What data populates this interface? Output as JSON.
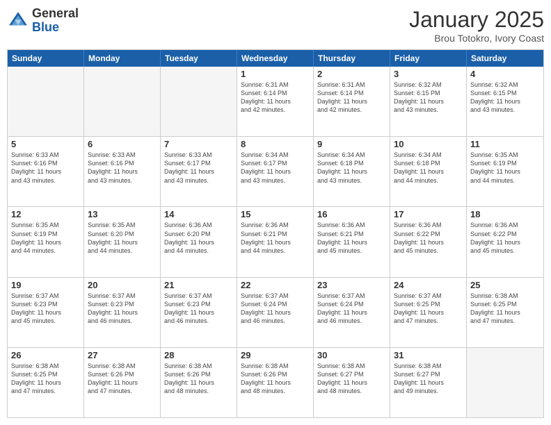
{
  "header": {
    "logo_general": "General",
    "logo_blue": "Blue",
    "month_title": "January 2025",
    "location": "Brou Totokro, Ivory Coast"
  },
  "days_of_week": [
    "Sunday",
    "Monday",
    "Tuesday",
    "Wednesday",
    "Thursday",
    "Friday",
    "Saturday"
  ],
  "weeks": [
    [
      {
        "day": "",
        "info": "",
        "empty": true
      },
      {
        "day": "",
        "info": "",
        "empty": true
      },
      {
        "day": "",
        "info": "",
        "empty": true
      },
      {
        "day": "1",
        "info": "Sunrise: 6:31 AM\nSunset: 6:14 PM\nDaylight: 11 hours\nand 42 minutes."
      },
      {
        "day": "2",
        "info": "Sunrise: 6:31 AM\nSunset: 6:14 PM\nDaylight: 11 hours\nand 42 minutes."
      },
      {
        "day": "3",
        "info": "Sunrise: 6:32 AM\nSunset: 6:15 PM\nDaylight: 11 hours\nand 43 minutes."
      },
      {
        "day": "4",
        "info": "Sunrise: 6:32 AM\nSunset: 6:15 PM\nDaylight: 11 hours\nand 43 minutes."
      }
    ],
    [
      {
        "day": "5",
        "info": "Sunrise: 6:33 AM\nSunset: 6:16 PM\nDaylight: 11 hours\nand 43 minutes."
      },
      {
        "day": "6",
        "info": "Sunrise: 6:33 AM\nSunset: 6:16 PM\nDaylight: 11 hours\nand 43 minutes."
      },
      {
        "day": "7",
        "info": "Sunrise: 6:33 AM\nSunset: 6:17 PM\nDaylight: 11 hours\nand 43 minutes."
      },
      {
        "day": "8",
        "info": "Sunrise: 6:34 AM\nSunset: 6:17 PM\nDaylight: 11 hours\nand 43 minutes."
      },
      {
        "day": "9",
        "info": "Sunrise: 6:34 AM\nSunset: 6:18 PM\nDaylight: 11 hours\nand 43 minutes."
      },
      {
        "day": "10",
        "info": "Sunrise: 6:34 AM\nSunset: 6:18 PM\nDaylight: 11 hours\nand 44 minutes."
      },
      {
        "day": "11",
        "info": "Sunrise: 6:35 AM\nSunset: 6:19 PM\nDaylight: 11 hours\nand 44 minutes."
      }
    ],
    [
      {
        "day": "12",
        "info": "Sunrise: 6:35 AM\nSunset: 6:19 PM\nDaylight: 11 hours\nand 44 minutes."
      },
      {
        "day": "13",
        "info": "Sunrise: 6:35 AM\nSunset: 6:20 PM\nDaylight: 11 hours\nand 44 minutes."
      },
      {
        "day": "14",
        "info": "Sunrise: 6:36 AM\nSunset: 6:20 PM\nDaylight: 11 hours\nand 44 minutes."
      },
      {
        "day": "15",
        "info": "Sunrise: 6:36 AM\nSunset: 6:21 PM\nDaylight: 11 hours\nand 44 minutes."
      },
      {
        "day": "16",
        "info": "Sunrise: 6:36 AM\nSunset: 6:21 PM\nDaylight: 11 hours\nand 45 minutes."
      },
      {
        "day": "17",
        "info": "Sunrise: 6:36 AM\nSunset: 6:22 PM\nDaylight: 11 hours\nand 45 minutes."
      },
      {
        "day": "18",
        "info": "Sunrise: 6:36 AM\nSunset: 6:22 PM\nDaylight: 11 hours\nand 45 minutes."
      }
    ],
    [
      {
        "day": "19",
        "info": "Sunrise: 6:37 AM\nSunset: 6:23 PM\nDaylight: 11 hours\nand 45 minutes."
      },
      {
        "day": "20",
        "info": "Sunrise: 6:37 AM\nSunset: 6:23 PM\nDaylight: 11 hours\nand 46 minutes."
      },
      {
        "day": "21",
        "info": "Sunrise: 6:37 AM\nSunset: 6:23 PM\nDaylight: 11 hours\nand 46 minutes."
      },
      {
        "day": "22",
        "info": "Sunrise: 6:37 AM\nSunset: 6:24 PM\nDaylight: 11 hours\nand 46 minutes."
      },
      {
        "day": "23",
        "info": "Sunrise: 6:37 AM\nSunset: 6:24 PM\nDaylight: 11 hours\nand 46 minutes."
      },
      {
        "day": "24",
        "info": "Sunrise: 6:37 AM\nSunset: 6:25 PM\nDaylight: 11 hours\nand 47 minutes."
      },
      {
        "day": "25",
        "info": "Sunrise: 6:38 AM\nSunset: 6:25 PM\nDaylight: 11 hours\nand 47 minutes."
      }
    ],
    [
      {
        "day": "26",
        "info": "Sunrise: 6:38 AM\nSunset: 6:25 PM\nDaylight: 11 hours\nand 47 minutes."
      },
      {
        "day": "27",
        "info": "Sunrise: 6:38 AM\nSunset: 6:26 PM\nDaylight: 11 hours\nand 47 minutes."
      },
      {
        "day": "28",
        "info": "Sunrise: 6:38 AM\nSunset: 6:26 PM\nDaylight: 11 hours\nand 48 minutes."
      },
      {
        "day": "29",
        "info": "Sunrise: 6:38 AM\nSunset: 6:26 PM\nDaylight: 11 hours\nand 48 minutes."
      },
      {
        "day": "30",
        "info": "Sunrise: 6:38 AM\nSunset: 6:27 PM\nDaylight: 11 hours\nand 48 minutes."
      },
      {
        "day": "31",
        "info": "Sunrise: 6:38 AM\nSunset: 6:27 PM\nDaylight: 11 hours\nand 49 minutes."
      },
      {
        "day": "",
        "info": "",
        "empty": true
      }
    ]
  ]
}
